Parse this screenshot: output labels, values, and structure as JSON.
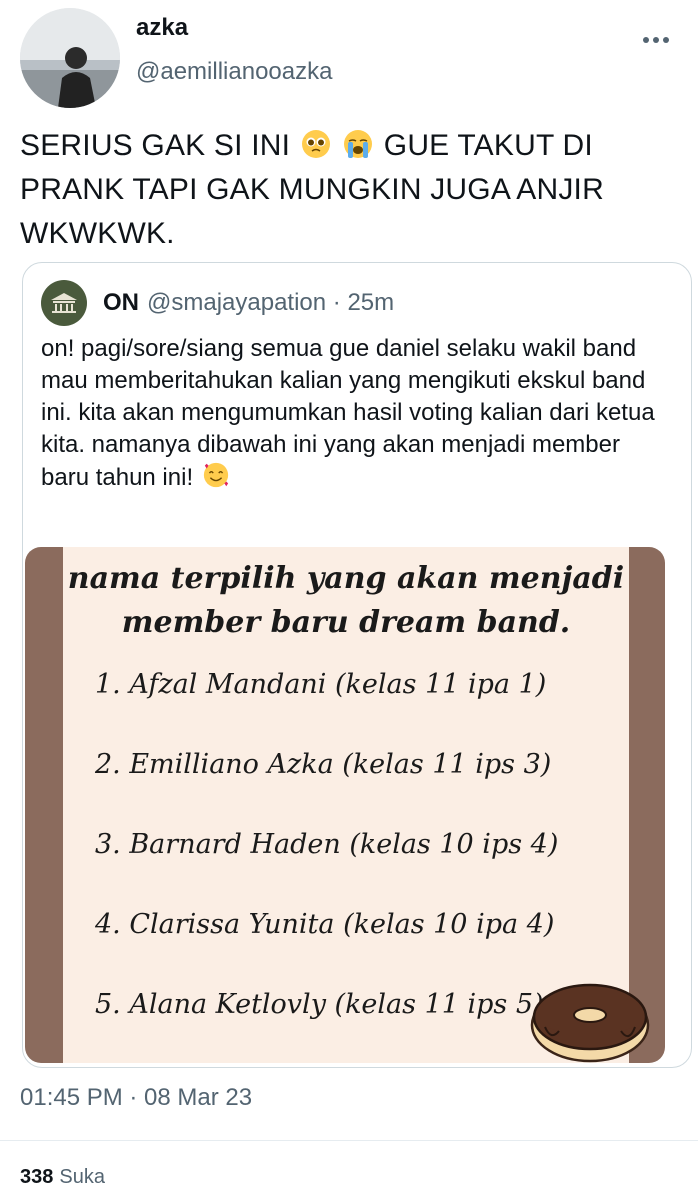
{
  "author": {
    "display_name": "azka",
    "handle": "@aemillianooazka"
  },
  "tweet": {
    "text_part1": "SERIUS GAK SI INI",
    "emoji1": "pleading-face",
    "emoji2": "loudly-crying-face",
    "text_part2": "GUE TAKUT DI PRANK TAPI GAK MUNGKIN JUGA ANJIR WKWKWK."
  },
  "quoted_tweet": {
    "name": "ON",
    "handle_time": "@smajayapation · 25m",
    "text": "on! pagi/sore/siang semua gue daniel selaku wakil band mau memberitahukan kalian yang mengikuti ekskul band ini. kita akan mengumumkan hasil voting kalian dari ketua kita. namanya dibawah ini yang akan menjadi member baru tahun ini!",
    "text_emoji": "smiling-face-with-hearts",
    "media": {
      "title": "nama terpilih yang akan menjadi member baru dream band.",
      "items": [
        "1. Afzal Mandani (kelas 11 ipa 1)",
        "2. Emilliano Azka (kelas 11 ips 3)",
        "3. Barnard Haden (kelas 10 ips 4)",
        "4. Clarissa Yunita (kelas 10 ipa 4)",
        "5. Alana Ketlovly (kelas 11 ips 5)"
      ]
    }
  },
  "footer": {
    "timestamp": "01:45 PM · 08 Mar 23",
    "likes_count": "338",
    "likes_label": "Suka"
  },
  "colors": {
    "text": "#0f1419",
    "secondary": "#536471",
    "border": "#cfd9de",
    "media_frame": "#8b6b5d",
    "paper": "#fbeee4"
  }
}
